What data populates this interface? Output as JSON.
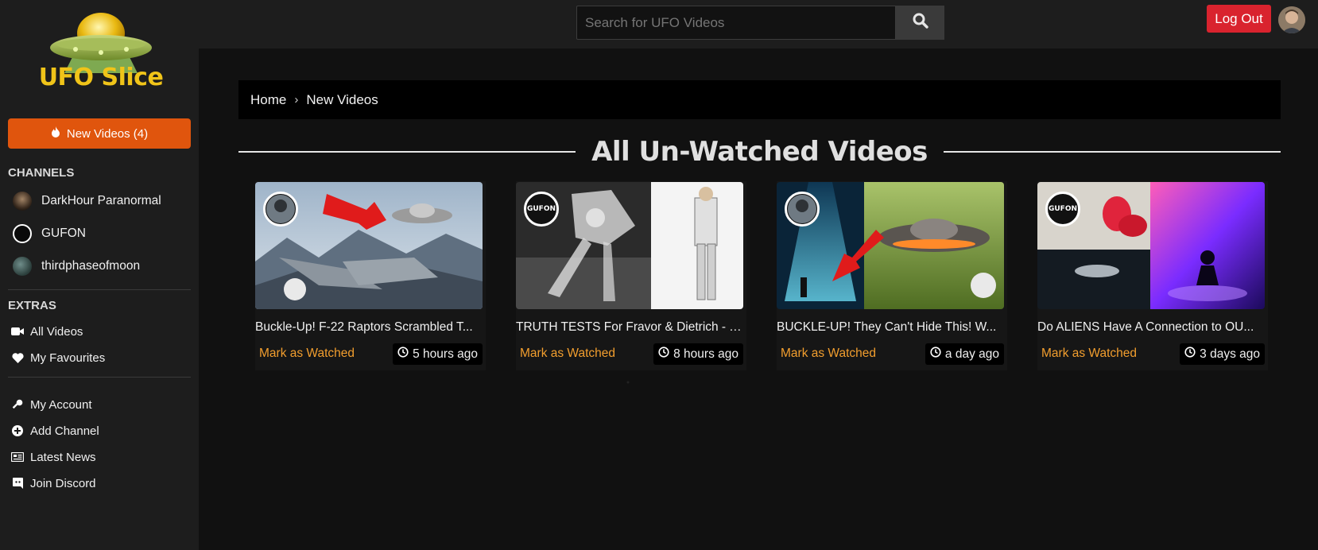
{
  "brand": {
    "name": "UFO Slice"
  },
  "sidebar": {
    "new_videos_label": "New Videos (4)",
    "channels_heading": "CHANNELS",
    "channels": [
      {
        "name": "DarkHour Paranormal"
      },
      {
        "name": "GUFON"
      },
      {
        "name": "thirdphaseofmoon"
      }
    ],
    "extras_heading": "EXTRAS",
    "extras": [
      {
        "label": "All Videos",
        "icon": "video-camera-icon"
      },
      {
        "label": "My Favourites",
        "icon": "heart-icon"
      }
    ],
    "account_links": [
      {
        "label": "My Account",
        "icon": "key-icon"
      },
      {
        "label": "Add Channel",
        "icon": "plus-circle-icon"
      },
      {
        "label": "Latest News",
        "icon": "newspaper-icon"
      },
      {
        "label": "Join Discord",
        "icon": "discord-icon"
      }
    ]
  },
  "header": {
    "search_placeholder": "Search for UFO Videos",
    "logout_label": "Log Out"
  },
  "breadcrumb": {
    "home": "Home",
    "current": "New Videos"
  },
  "main": {
    "title": "All Un-Watched Videos",
    "videos": [
      {
        "title": "Buckle-Up! F-22 Raptors Scrambled T...",
        "mark_label": "Mark as Watched",
        "time": "5 hours ago"
      },
      {
        "title": "TRUTH TESTS For Fravor & Dietrich - T...",
        "mark_label": "Mark as Watched",
        "time": "8 hours ago"
      },
      {
        "title": "BUCKLE-UP! They Can't Hide This! W...",
        "mark_label": "Mark as Watched",
        "time": "a day ago"
      },
      {
        "title": "Do ALIENS Have A Connection to OU...",
        "mark_label": "Mark as Watched",
        "time": "3 days ago"
      }
    ]
  },
  "colors": {
    "accent_orange": "#e0550d",
    "logout_red": "#d9232e",
    "mark_orange": "#f29e2e",
    "logo_yellow": "#f0c419"
  }
}
